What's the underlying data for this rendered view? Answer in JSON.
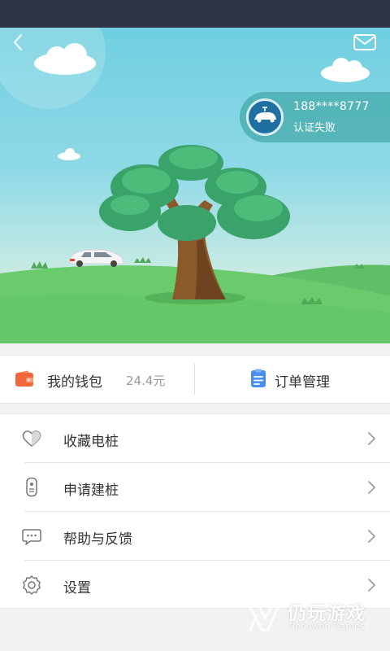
{
  "account": {
    "phone": "188****8777",
    "status": "认证失败"
  },
  "quick_actions": {
    "wallet_label": "我的钱包",
    "wallet_amount": "24.4元",
    "orders_label": "订单管理"
  },
  "menu": {
    "items": [
      {
        "label": "收藏电桩",
        "icon": "heart-icon"
      },
      {
        "label": "申请建桩",
        "icon": "charger-icon"
      },
      {
        "label": "帮助与反馈",
        "icon": "chat-bubble-icon"
      },
      {
        "label": "设置",
        "icon": "gear-icon"
      }
    ]
  },
  "watermark": {
    "name_cn": "仍玩游戏",
    "name_en": "Rengwan Games"
  },
  "colors": {
    "status_bar": "#2f3447",
    "wallet_accent": "#f0673b",
    "orders_accent": "#4a8df0",
    "account_card": "#48acac"
  }
}
